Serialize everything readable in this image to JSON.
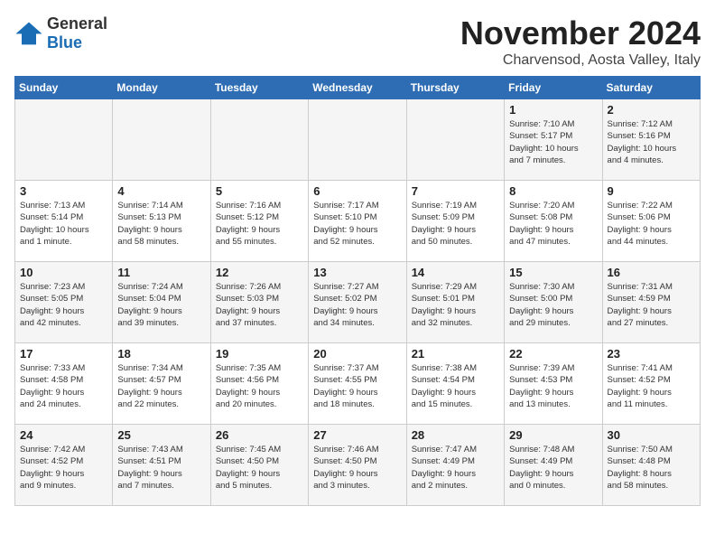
{
  "header": {
    "logo_general": "General",
    "logo_blue": "Blue",
    "month_title": "November 2024",
    "location": "Charvensod, Aosta Valley, Italy"
  },
  "weekdays": [
    "Sunday",
    "Monday",
    "Tuesday",
    "Wednesday",
    "Thursday",
    "Friday",
    "Saturday"
  ],
  "weeks": [
    [
      {
        "day": "",
        "info": ""
      },
      {
        "day": "",
        "info": ""
      },
      {
        "day": "",
        "info": ""
      },
      {
        "day": "",
        "info": ""
      },
      {
        "day": "",
        "info": ""
      },
      {
        "day": "1",
        "info": "Sunrise: 7:10 AM\nSunset: 5:17 PM\nDaylight: 10 hours\nand 7 minutes."
      },
      {
        "day": "2",
        "info": "Sunrise: 7:12 AM\nSunset: 5:16 PM\nDaylight: 10 hours\nand 4 minutes."
      }
    ],
    [
      {
        "day": "3",
        "info": "Sunrise: 7:13 AM\nSunset: 5:14 PM\nDaylight: 10 hours\nand 1 minute."
      },
      {
        "day": "4",
        "info": "Sunrise: 7:14 AM\nSunset: 5:13 PM\nDaylight: 9 hours\nand 58 minutes."
      },
      {
        "day": "5",
        "info": "Sunrise: 7:16 AM\nSunset: 5:12 PM\nDaylight: 9 hours\nand 55 minutes."
      },
      {
        "day": "6",
        "info": "Sunrise: 7:17 AM\nSunset: 5:10 PM\nDaylight: 9 hours\nand 52 minutes."
      },
      {
        "day": "7",
        "info": "Sunrise: 7:19 AM\nSunset: 5:09 PM\nDaylight: 9 hours\nand 50 minutes."
      },
      {
        "day": "8",
        "info": "Sunrise: 7:20 AM\nSunset: 5:08 PM\nDaylight: 9 hours\nand 47 minutes."
      },
      {
        "day": "9",
        "info": "Sunrise: 7:22 AM\nSunset: 5:06 PM\nDaylight: 9 hours\nand 44 minutes."
      }
    ],
    [
      {
        "day": "10",
        "info": "Sunrise: 7:23 AM\nSunset: 5:05 PM\nDaylight: 9 hours\nand 42 minutes."
      },
      {
        "day": "11",
        "info": "Sunrise: 7:24 AM\nSunset: 5:04 PM\nDaylight: 9 hours\nand 39 minutes."
      },
      {
        "day": "12",
        "info": "Sunrise: 7:26 AM\nSunset: 5:03 PM\nDaylight: 9 hours\nand 37 minutes."
      },
      {
        "day": "13",
        "info": "Sunrise: 7:27 AM\nSunset: 5:02 PM\nDaylight: 9 hours\nand 34 minutes."
      },
      {
        "day": "14",
        "info": "Sunrise: 7:29 AM\nSunset: 5:01 PM\nDaylight: 9 hours\nand 32 minutes."
      },
      {
        "day": "15",
        "info": "Sunrise: 7:30 AM\nSunset: 5:00 PM\nDaylight: 9 hours\nand 29 minutes."
      },
      {
        "day": "16",
        "info": "Sunrise: 7:31 AM\nSunset: 4:59 PM\nDaylight: 9 hours\nand 27 minutes."
      }
    ],
    [
      {
        "day": "17",
        "info": "Sunrise: 7:33 AM\nSunset: 4:58 PM\nDaylight: 9 hours\nand 24 minutes."
      },
      {
        "day": "18",
        "info": "Sunrise: 7:34 AM\nSunset: 4:57 PM\nDaylight: 9 hours\nand 22 minutes."
      },
      {
        "day": "19",
        "info": "Sunrise: 7:35 AM\nSunset: 4:56 PM\nDaylight: 9 hours\nand 20 minutes."
      },
      {
        "day": "20",
        "info": "Sunrise: 7:37 AM\nSunset: 4:55 PM\nDaylight: 9 hours\nand 18 minutes."
      },
      {
        "day": "21",
        "info": "Sunrise: 7:38 AM\nSunset: 4:54 PM\nDaylight: 9 hours\nand 15 minutes."
      },
      {
        "day": "22",
        "info": "Sunrise: 7:39 AM\nSunset: 4:53 PM\nDaylight: 9 hours\nand 13 minutes."
      },
      {
        "day": "23",
        "info": "Sunrise: 7:41 AM\nSunset: 4:52 PM\nDaylight: 9 hours\nand 11 minutes."
      }
    ],
    [
      {
        "day": "24",
        "info": "Sunrise: 7:42 AM\nSunset: 4:52 PM\nDaylight: 9 hours\nand 9 minutes."
      },
      {
        "day": "25",
        "info": "Sunrise: 7:43 AM\nSunset: 4:51 PM\nDaylight: 9 hours\nand 7 minutes."
      },
      {
        "day": "26",
        "info": "Sunrise: 7:45 AM\nSunset: 4:50 PM\nDaylight: 9 hours\nand 5 minutes."
      },
      {
        "day": "27",
        "info": "Sunrise: 7:46 AM\nSunset: 4:50 PM\nDaylight: 9 hours\nand 3 minutes."
      },
      {
        "day": "28",
        "info": "Sunrise: 7:47 AM\nSunset: 4:49 PM\nDaylight: 9 hours\nand 2 minutes."
      },
      {
        "day": "29",
        "info": "Sunrise: 7:48 AM\nSunset: 4:49 PM\nDaylight: 9 hours\nand 0 minutes."
      },
      {
        "day": "30",
        "info": "Sunrise: 7:50 AM\nSunset: 4:48 PM\nDaylight: 8 hours\nand 58 minutes."
      }
    ]
  ]
}
